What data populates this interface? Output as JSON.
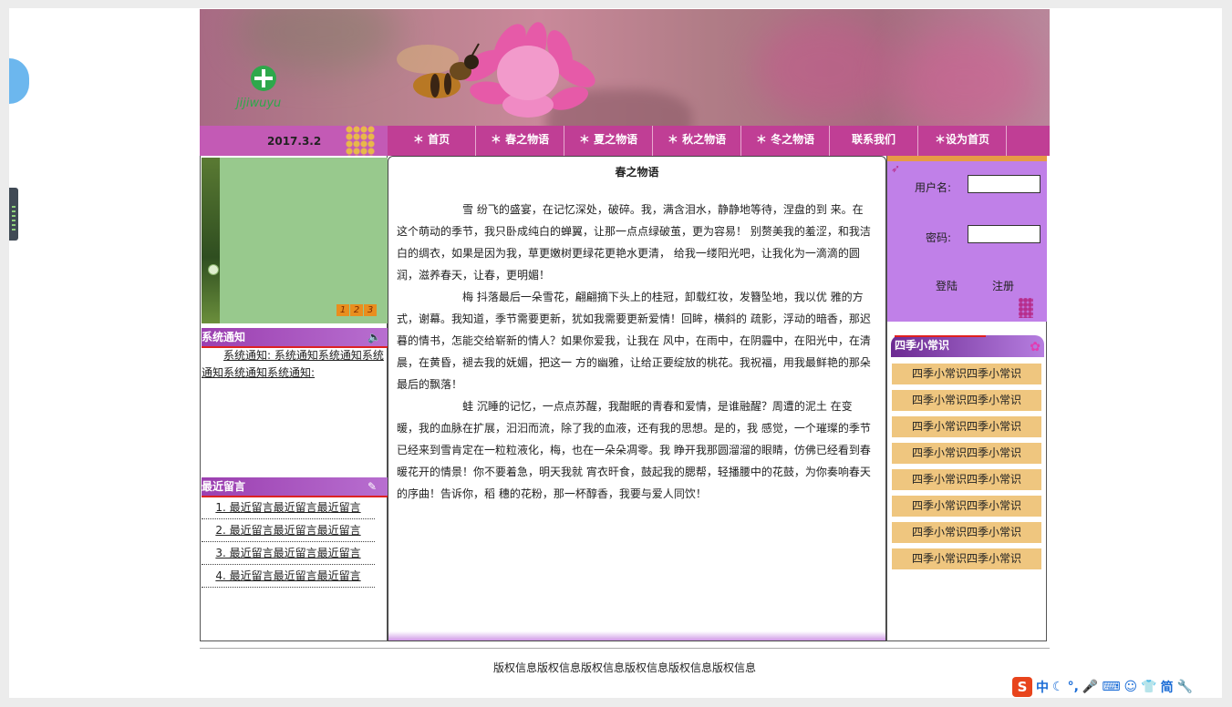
{
  "site": {
    "logo_text": "jijiwuyu",
    "date": "2017.3.2"
  },
  "nav": {
    "items": [
      "＊ 首页",
      "＊ 春之物语",
      "＊ 夏之物语",
      "＊ 秋之物语",
      "＊ 冬之物语",
      "联系我们",
      "＊设为首页"
    ]
  },
  "slider": {
    "pages": [
      "1",
      "2",
      "3"
    ]
  },
  "notice": {
    "title": "系统通知",
    "text": "系统通知: 系统通知系统通知系统通知系统通知系统通知:"
  },
  "messages": {
    "title": "最近留言",
    "items": [
      "1. 最近留言最近留言最近留言",
      "2. 最近留言最近留言最近留言",
      "3. 最近留言最近留言最近留言",
      "4. 最近留言最近留言最近留言"
    ]
  },
  "article": {
    "title": "春之物语",
    "paragraphs": [
      "雪 纷飞的盛宴，在记忆深处，破碎。我，满含泪水，静静地等待，涅盘的到 来。在这个萌动的季节，我只卧成纯白的蝉翼，让那一点点绿破茧，更为容易！ 别赘美我的羞涩，和我洁白的绸衣，如果是因为我，草更嫩树更绿花更艳水更清， 给我一缕阳光吧，让我化为一滴滴的圆润，滋养春天，让春，更明媚！",
      "梅 抖落最后一朵雪花，翩翩摘下头上的桂冠，卸载红妆，发簪坠地，我以优 雅的方式，谢幕。我知道，季节需要更新，犹如我需要更新爱情！回眸，横斜的 疏影，浮动的暗香，那迟暮的情书，怎能交给崭新的情人？如果你爱我，让我在 风中，在雨中，在阴霾中，在阳光中，在清晨，在黄昏，褪去我的妩媚，把这一 方的幽雅，让给正要绽放的桃花。我祝福，用我最鲜艳的那朵最后的飘落！",
      "蛙 沉睡的记忆，一点点苏醒，我酣眠的青春和爱情，是谁融醒？周遭的泥土 在变暖，我的血脉在扩展，汩汩而流，除了我的血液，还有我的思想。是的，我 感觉，一个璀璨的季节已经来到雪肯定在一粒粒液化，梅，也在一朵朵凋零。我 睁开我那圆溜溜的眼睛，仿佛已经看到春暖花开的情景！你不要着急，明天我就 宵衣旰食，鼓起我的腮帮，轻播腰中的花鼓，为你奏响春天的序曲！告诉你，稻 穗的花粉，那一杯醇香，我要与爱人同饮！"
    ]
  },
  "login": {
    "username_label": "用户名:",
    "password_label": "密码:",
    "login_label": "登陆",
    "register_label": "注册",
    "username_value": "",
    "password_value": ""
  },
  "tips": {
    "title": "四季小常识",
    "items": [
      "四季小常识四季小常识",
      "四季小常识四季小常识",
      "四季小常识四季小常识",
      "四季小常识四季小常识",
      "四季小常识四季小常识",
      "四季小常识四季小常识",
      "四季小常识四季小常识",
      "四季小常识四季小常识"
    ]
  },
  "footer": {
    "text": "版权信息版权信息版权信息版权信息版权信息版权信息"
  },
  "ime": {
    "logo": "S",
    "lang": "中"
  },
  "colors": {
    "nav_bg": "#c03e95",
    "panel_purple": "#c080e8",
    "tip_bg": "#efc67f"
  }
}
